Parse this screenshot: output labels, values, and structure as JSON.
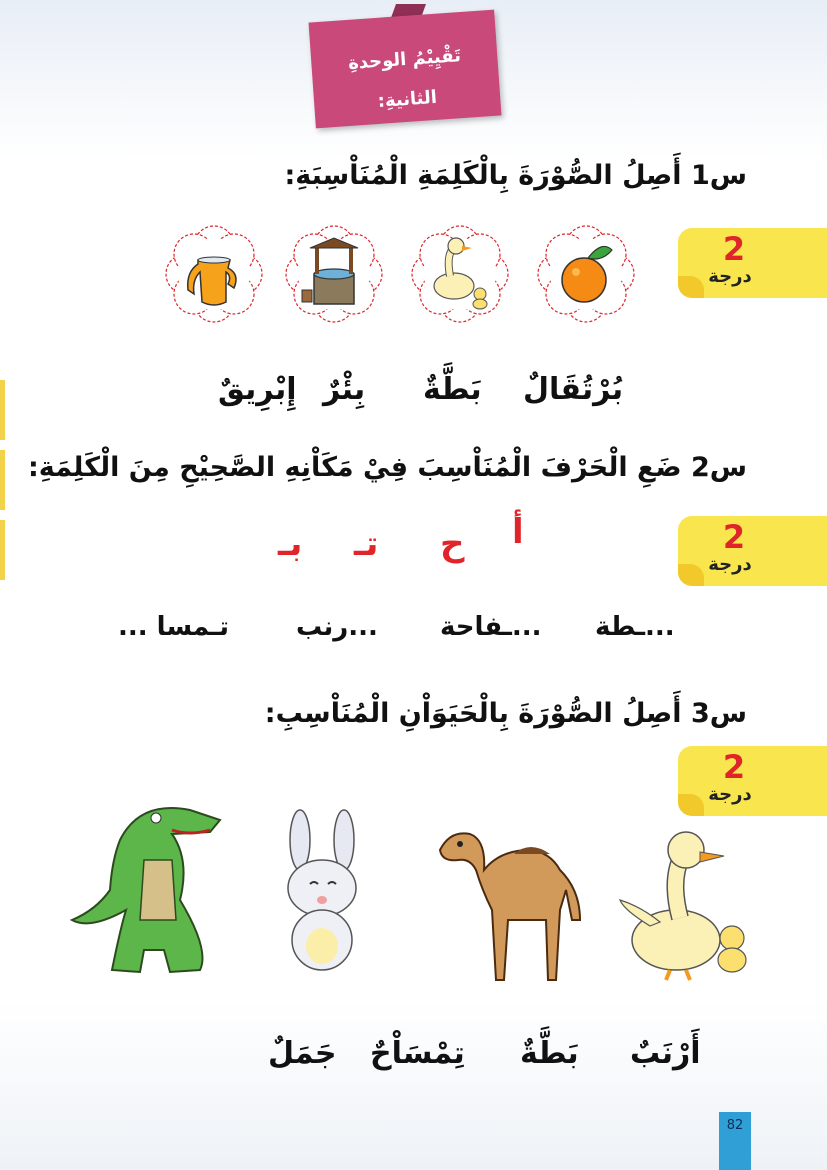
{
  "banner": {
    "line1": "تَقْيِيْمُ الوحدةِ",
    "line2": "الثانيةِ:"
  },
  "q1": {
    "text": "س1 أَصِلُ الصُّوْرَةَ بِالْكَلِمَةِ الْمُنَاْسِبَةِ:",
    "badge_num": "2",
    "badge_label": "درجة",
    "pictures": [
      "orange-icon",
      "duck-icon",
      "well-icon",
      "jug-icon"
    ],
    "words": [
      "بُرْتُقَالٌ",
      "بَطَّةٌ",
      "بِئْرٌ",
      "إِبْرِيقٌ"
    ]
  },
  "q2": {
    "text": "س2 ضَعِ الْحَرْفَ الْمُنَاْسِبَ فِيْ مَكَاْنِهِ الصَّحِيْحِ مِنَ الْكَلِمَةِ:",
    "badge_num": "2",
    "badge_label": "درجة",
    "letters": [
      "أ",
      "ح",
      "تـ",
      "بـ"
    ],
    "words": [
      "...ـطة",
      "...ـفاحة",
      "...رنب",
      "تـمسا ..."
    ]
  },
  "q3": {
    "text": "س3 أَصِلُ الصُّوْرَةَ بِالْحَيَوَاْنِ الْمُنَاْسِبِ:",
    "badge_num": "2",
    "badge_label": "درجة",
    "animals": [
      "duck-icon",
      "camel-icon",
      "rabbit-icon",
      "crocodile-icon"
    ],
    "words": [
      "أَرْنَبٌ",
      "بَطَّةٌ",
      "تِمْسَاْحٌ",
      "جَمَلٌ"
    ]
  },
  "page_number": "82",
  "colors": {
    "banner": "#c8497a",
    "badge": "#f9e54e",
    "red": "#e0242a",
    "page_box": "#2f9fd6"
  }
}
